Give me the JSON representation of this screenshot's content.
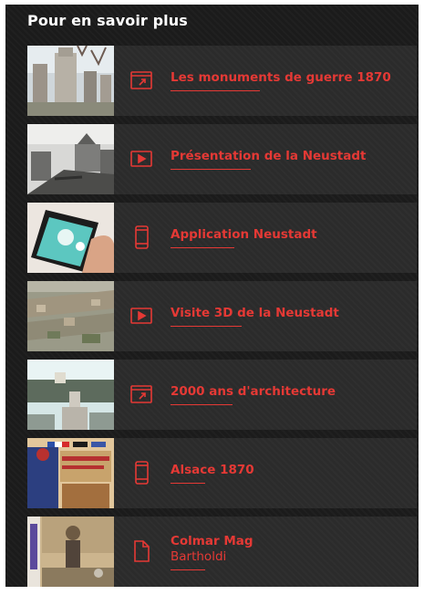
{
  "section": {
    "title": "Pour en savoir plus"
  },
  "accent_color": "#e53935",
  "items": [
    {
      "title": "Les monuments de guerre 1870",
      "icon": "external-link-icon",
      "thumb": "war-monument-photo"
    },
    {
      "title": "Présentation de la Neustadt",
      "icon": "video-play-icon",
      "thumb": "neustadt-old-street-photo"
    },
    {
      "title": "Application Neustadt",
      "icon": "smartphone-icon",
      "thumb": "phone-in-hand-photo"
    },
    {
      "title": "Visite 3D de la Neustadt",
      "icon": "video-play-icon",
      "thumb": "aerial-city-3d-photo"
    },
    {
      "title": "2000 ans d'architecture",
      "icon": "external-link-icon",
      "thumb": "historic-architecture-photo"
    },
    {
      "title": "Alsace 1870",
      "icon": "smartphone-icon",
      "thumb": "alsace-1870-poster"
    },
    {
      "title": "Colmar Mag",
      "subtitle": "Bartholdi",
      "icon": "document-icon",
      "thumb": "colmar-mag-cover"
    }
  ]
}
